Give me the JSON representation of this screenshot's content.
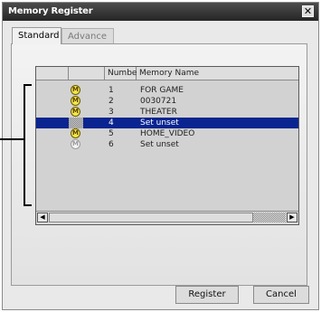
{
  "window": {
    "title": "Memory Register",
    "close_glyph": "✕"
  },
  "tabs": [
    {
      "label": "Standard",
      "active": true
    },
    {
      "label": "Advance",
      "active": false
    }
  ],
  "list": {
    "columns": [
      "",
      "",
      "Number",
      "Memory Name"
    ],
    "rows": [
      {
        "icon": "memory-m-icon",
        "icon_state": "yellow",
        "number": "1",
        "name": "FOR GAME",
        "selected": false
      },
      {
        "icon": "memory-m-icon",
        "icon_state": "yellow",
        "number": "2",
        "name": "0030721",
        "selected": false
      },
      {
        "icon": "memory-m-icon",
        "icon_state": "yellow",
        "number": "3",
        "name": "THEATER",
        "selected": false
      },
      {
        "icon": "empty-slot-icon",
        "icon_state": "checker",
        "number": "4",
        "name": "Set unset",
        "selected": true
      },
      {
        "icon": "memory-m-icon",
        "icon_state": "yellow",
        "number": "5",
        "name": "HOME_VIDEO",
        "selected": false
      },
      {
        "icon": "memory-m-icon",
        "icon_state": "white",
        "number": "6",
        "name": "Set unset",
        "selected": false
      }
    ],
    "icon_letter": "M"
  },
  "scroll": {
    "left_arrow": "◀",
    "right_arrow": "▶"
  },
  "buttons": {
    "register": "Register",
    "cancel": "Cancel"
  },
  "colors": {
    "selection": "#0a2490",
    "icon_yellow": "#f2e64a"
  }
}
